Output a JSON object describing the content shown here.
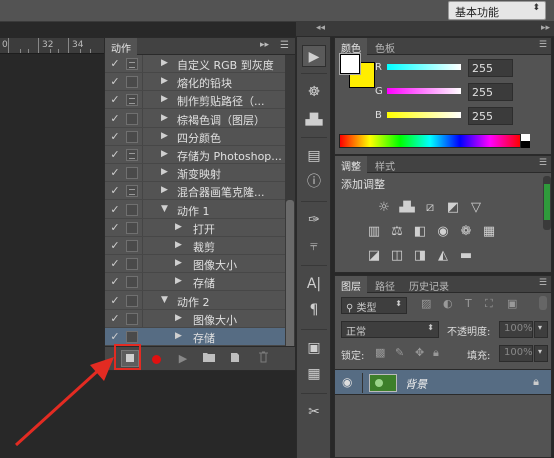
{
  "workspace": {
    "label": "基本功能"
  },
  "ruler": {
    "marks": [
      "0",
      "32",
      "34"
    ]
  },
  "actions_panel": {
    "tab": "动作",
    "items": [
      {
        "label": "自定义 RGB 到灰度",
        "checked": true,
        "dialog": true,
        "indent": 0,
        "expanded": false
      },
      {
        "label": "熔化的铅块",
        "checked": true,
        "dialog": false,
        "indent": 0,
        "expanded": false
      },
      {
        "label": "制作剪贴路径（...",
        "checked": true,
        "dialog": true,
        "indent": 0,
        "expanded": false
      },
      {
        "label": "棕褐色调（图层）",
        "checked": true,
        "dialog": false,
        "indent": 0,
        "expanded": false
      },
      {
        "label": "四分颜色",
        "checked": true,
        "dialog": false,
        "indent": 0,
        "expanded": false
      },
      {
        "label": "存储为 Photoshop...",
        "checked": true,
        "dialog": true,
        "indent": 0,
        "expanded": false
      },
      {
        "label": "渐变映射",
        "checked": true,
        "dialog": false,
        "indent": 0,
        "expanded": false
      },
      {
        "label": "混合器画笔克隆...",
        "checked": true,
        "dialog": true,
        "indent": 0,
        "expanded": false
      },
      {
        "label": "动作 1",
        "checked": true,
        "dialog": false,
        "indent": 0,
        "expanded": true
      },
      {
        "label": "打开",
        "checked": true,
        "dialog": false,
        "indent": 1,
        "expanded": false
      },
      {
        "label": "裁剪",
        "checked": true,
        "dialog": false,
        "indent": 1,
        "expanded": false
      },
      {
        "label": "图像大小",
        "checked": true,
        "dialog": false,
        "indent": 1,
        "expanded": false
      },
      {
        "label": "存储",
        "checked": true,
        "dialog": false,
        "indent": 1,
        "expanded": false
      },
      {
        "label": "动作 2",
        "checked": true,
        "dialog": false,
        "indent": 0,
        "expanded": true
      },
      {
        "label": "图像大小",
        "checked": true,
        "dialog": false,
        "indent": 1,
        "expanded": false
      },
      {
        "label": "存储",
        "checked": true,
        "dialog": false,
        "indent": 1,
        "expanded": false,
        "selected": true
      }
    ],
    "bottom_icons": [
      "stop-icon",
      "record-icon",
      "play-icon",
      "folder-icon",
      "new-action-icon",
      "trash-icon"
    ]
  },
  "color_panel": {
    "tabs": [
      "颜色",
      "色板"
    ],
    "channels": [
      {
        "label": "R",
        "value": "255"
      },
      {
        "label": "G",
        "value": "255"
      },
      {
        "label": "B",
        "value": "255"
      }
    ],
    "foreground_color": "#ffffff",
    "background_color": "#ffee00"
  },
  "adjustments_panel": {
    "tabs": [
      "调整",
      "样式"
    ],
    "title": "添加调整"
  },
  "layers_panel": {
    "tabs": [
      "图层",
      "路径",
      "历史记录"
    ],
    "filter_label": "类型",
    "blend_mode": "正常",
    "opacity_label": "不透明度:",
    "opacity_value": "100%",
    "lock_label": "锁定:",
    "fill_label": "填充:",
    "fill_value": "100%",
    "layer_name": "背景"
  },
  "colors": {
    "accent_red": "#e32b22",
    "selection_blue": "#566c83"
  }
}
